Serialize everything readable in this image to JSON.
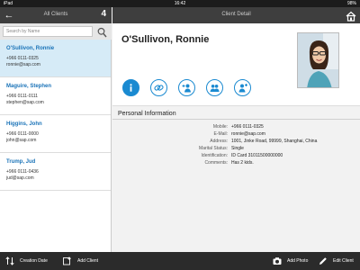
{
  "status_bar": {
    "carrier": "iPad",
    "time": "16:42",
    "battery": "98%"
  },
  "master": {
    "title": "All Clients",
    "count": "4",
    "search": {
      "placeholder": "Search by Name",
      "value": ""
    },
    "clients": [
      {
        "name": "O'Sullivon, Ronnie",
        "phone": "+966 0111-0325",
        "email": "ronnie@sap.com",
        "selected": true
      },
      {
        "name": "Maguire, Stephen",
        "phone": "+966 0111-0111",
        "email": "stephen@sap.com",
        "selected": false
      },
      {
        "name": "Higgins, John",
        "phone": "+966 0111-0000",
        "email": "john@sap.com",
        "selected": false
      },
      {
        "name": "Trump, Jud",
        "phone": "+966 0111-0436",
        "email": "jud@sap.com",
        "selected": false
      }
    ]
  },
  "detail": {
    "title": "Client Detail",
    "client_name": "O'Sullivon, Ronnie",
    "actions": [
      "info-icon",
      "link-icon",
      "add-contact-icon",
      "group-icon",
      "add-person-icon"
    ],
    "section_title": "Personal Information",
    "fields": [
      {
        "label": "Mobile:",
        "value": "+966 0111-0325"
      },
      {
        "label": "E-Mail:",
        "value": "ronnie@sap.com"
      },
      {
        "label": "Address:",
        "value": "1001, Jinke Road, 99999, Shanghai, China"
      },
      {
        "label": "Marital Status:",
        "value": "Single"
      },
      {
        "label": "Identification:",
        "value": "ID Card 31011500000000"
      },
      {
        "label": "Comments:",
        "value": "Has 2 kids."
      }
    ]
  },
  "bottom_bar": {
    "creation_date": "Creation Date",
    "add_client": "Add Client",
    "add_photo": "Add Photo",
    "edit_client": "Edit Client"
  },
  "colors": {
    "accent": "#1a8ad1",
    "link": "#1a73b8",
    "bar": "#2b2b2b",
    "selected_row": "#d6ebf7"
  }
}
